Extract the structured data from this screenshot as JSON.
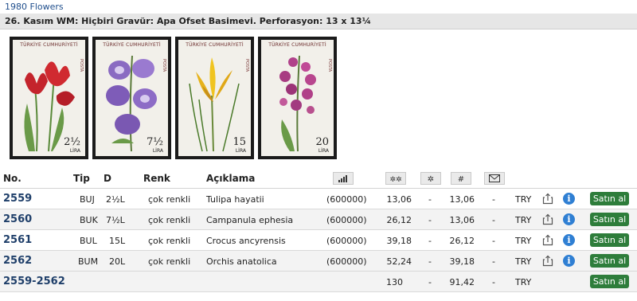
{
  "breadcrumb": "1980 Flowers",
  "header": {
    "title": "26. Kasım WM: Hiçbiri Gravür: Apa Ofset Basimevi. Perforasyon: 13 x 13¼"
  },
  "stamps": [
    {
      "country": "TÜRKİYE CUMHURİYETİ",
      "value": "2½",
      "unit": "LİRA",
      "side": "POSTA"
    },
    {
      "country": "TÜRKİYE CUMHURİYETİ",
      "value": "7½",
      "unit": "LİRA",
      "side": "POSTA"
    },
    {
      "country": "TÜRKİYE CUMHURİYETİ",
      "value": "15",
      "unit": "LİRA",
      "side": "POSTA"
    },
    {
      "country": "TÜRKİYE CUMHURİYETİ",
      "value": "20",
      "unit": "LİRA",
      "side": "POSTA"
    }
  ],
  "columns": {
    "no": "No.",
    "tip": "Tip",
    "d": "D",
    "renk": "Renk",
    "aciklama": "Açıklama"
  },
  "icons": [
    "bar-chart-icon",
    "mint-stars-icon",
    "hinged-star-icon",
    "used-mark-icon",
    "cover-envelope-icon"
  ],
  "rows": [
    {
      "no": "2559",
      "tip": "BUJ",
      "d": "2½L",
      "renk": "çok renkli",
      "desc": "Tulipa hayatii",
      "qty": "(600000)",
      "p1": "13,06",
      "p2": "-",
      "p3": "13,06",
      "p4": "-",
      "cur": "TRY",
      "buy": "Satın al"
    },
    {
      "no": "2560",
      "tip": "BUK",
      "d": "7½L",
      "renk": "çok renkli",
      "desc": "Campanula ephesia",
      "qty": "(600000)",
      "p1": "26,12",
      "p2": "-",
      "p3": "13,06",
      "p4": "-",
      "cur": "TRY",
      "buy": "Satın al"
    },
    {
      "no": "2561",
      "tip": "BUL",
      "d": "15L",
      "renk": "çok renkli",
      "desc": "Crocus ancyrensis",
      "qty": "(600000)",
      "p1": "39,18",
      "p2": "-",
      "p3": "26,12",
      "p4": "-",
      "cur": "TRY",
      "buy": "Satın al"
    },
    {
      "no": "2562",
      "tip": "BUM",
      "d": "20L",
      "renk": "çok renkli",
      "desc": "Orchis anatolica",
      "qty": "(600000)",
      "p1": "52,24",
      "p2": "-",
      "p3": "39,18",
      "p4": "-",
      "cur": "TRY",
      "buy": "Satın al"
    }
  ],
  "total": {
    "no": "2559-2562",
    "p1": "130",
    "p2": "-",
    "p3": "91,42",
    "p4": "-",
    "cur": "TRY",
    "buy": "Satın al"
  },
  "colors": {
    "link": "#1f3f6a",
    "buy": "#2e7d3b",
    "info": "#2f7fd3"
  }
}
